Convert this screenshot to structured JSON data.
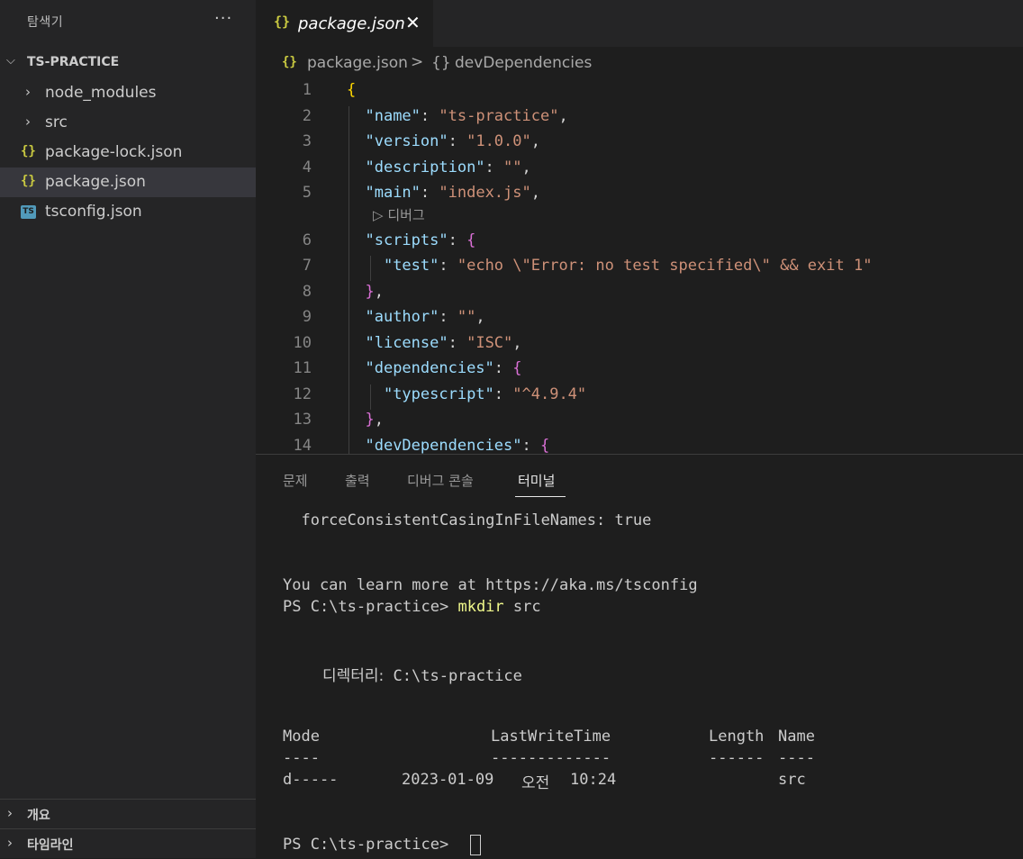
{
  "sidebar": {
    "title": "탐색기",
    "more_icon": "more-icon",
    "project": "TS-PRACTICE",
    "items": [
      {
        "label": "node_modules",
        "type": "folder"
      },
      {
        "label": "src",
        "type": "folder"
      },
      {
        "label": "package-lock.json",
        "type": "json"
      },
      {
        "label": "package.json",
        "type": "json",
        "selected": true
      },
      {
        "label": "tsconfig.json",
        "type": "ts"
      }
    ],
    "outline": "개요",
    "timeline": "타임라인"
  },
  "tab": {
    "icon_text": "{}",
    "label": "package.json",
    "close": "✕"
  },
  "breadcrumb": {
    "icon_text": "{}",
    "file": "package.json",
    "separator": ">",
    "section_icon": "{}",
    "section": "devDependencies"
  },
  "editor": {
    "line_numbers": [
      "1",
      "2",
      "3",
      "4",
      "5",
      "6",
      "7",
      "8",
      "9",
      "10",
      "11",
      "12",
      "13",
      "14"
    ],
    "codelens": "디버그",
    "codelens_icon": "▷",
    "lines": {
      "l1": {
        "brace": "{"
      },
      "l2": {
        "key": "\"name\"",
        "colon": ": ",
        "value": "\"ts-practice\"",
        "comma": ","
      },
      "l3": {
        "key": "\"version\"",
        "colon": ": ",
        "value": "\"1.0.0\"",
        "comma": ","
      },
      "l4": {
        "key": "\"description\"",
        "colon": ": ",
        "value": "\"\"",
        "comma": ","
      },
      "l5": {
        "key": "\"main\"",
        "colon": ": ",
        "value": "\"index.js\"",
        "comma": ","
      },
      "l6": {
        "key": "\"scripts\"",
        "colon": ": ",
        "brace": "{"
      },
      "l7": {
        "key": "\"test\"",
        "colon": ": ",
        "value": "\"echo \\\"Error: no test specified\\\" && exit 1\""
      },
      "l8": {
        "brace": "}",
        "comma": ","
      },
      "l9": {
        "key": "\"author\"",
        "colon": ": ",
        "value": "\"\"",
        "comma": ","
      },
      "l10": {
        "key": "\"license\"",
        "colon": ": ",
        "value": "\"ISC\"",
        "comma": ","
      },
      "l11": {
        "key": "\"dependencies\"",
        "colon": ": ",
        "brace": "{"
      },
      "l12": {
        "key": "\"typescript\"",
        "colon": ": ",
        "value": "\"^4.9.4\""
      },
      "l13": {
        "brace": "}",
        "comma": ","
      },
      "l14": {
        "key": "\"devDependencies\"",
        "colon": ": ",
        "brace": "{"
      }
    }
  },
  "panel": {
    "tabs": [
      "문제",
      "출력",
      "디버그 콘솔",
      "터미널"
    ],
    "active_tab": "터미널",
    "terminal": {
      "line1": "  forceConsistentCasingInFileNames: true",
      "line2": "You can learn more at https://aka.ms/tsconfig",
      "prompt": "PS C:\\ts-practice> ",
      "cmd": "mkdir",
      "cmd_arg": " src",
      "dir_label": "디렉터리:",
      "dir_path": " C:\\ts-practice",
      "hdr_mode": "Mode",
      "hdr_time": "LastWriteTime",
      "hdr_length": "Length",
      "hdr_name": "Name",
      "sep_mode": "----",
      "sep_time": "-------------",
      "sep_length": "------",
      "sep_name": "----",
      "row_mode": "d-----",
      "row_date": "2023-01-09",
      "row_ampm": "오전",
      "row_time": "10:24",
      "row_name": "src",
      "final_prompt": "PS C:\\ts-practice> "
    }
  },
  "colors": {
    "background": "#1e1e1e",
    "sidebar": "#252526",
    "json_key": "#9cdcfe",
    "json_string": "#ce9178",
    "bracket_gold": "#ffd700",
    "bracket_purple": "#da70d6",
    "json_icon": "#cbcb41",
    "ts_icon": "#519aba",
    "terminal_command": "#f1fa8c"
  }
}
